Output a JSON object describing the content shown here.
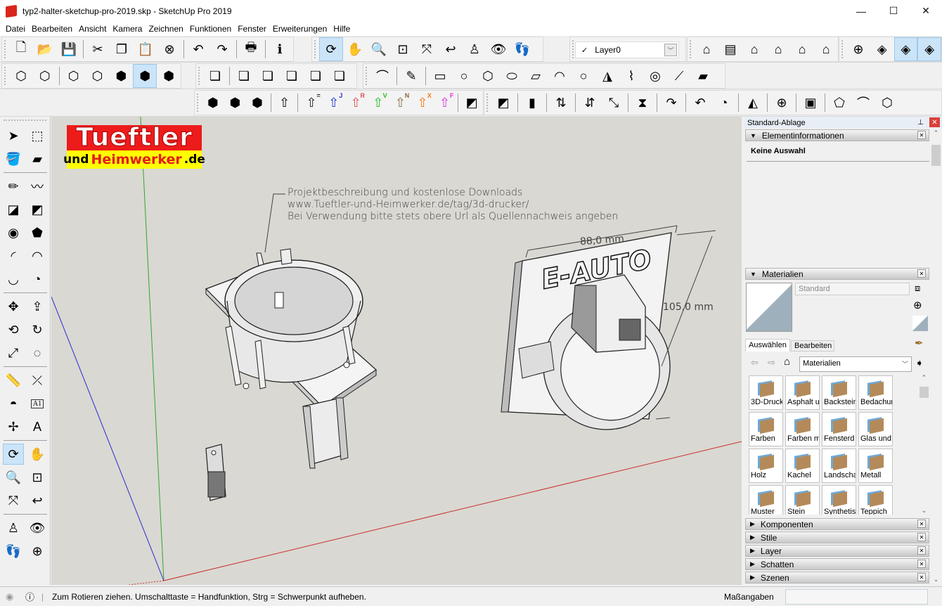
{
  "window": {
    "title": "typ2-halter-sketchup-pro-2019.skp - SketchUp Pro 2019",
    "app_icon": "sketchup-logo-icon",
    "controls": {
      "minimize": "—",
      "maximize": "☐",
      "close": "✕"
    }
  },
  "menubar": [
    "Datei",
    "Bearbeiten",
    "Ansicht",
    "Kamera",
    "Zeichnen",
    "Funktionen",
    "Fenster",
    "Erweiterungen",
    "Hilfe"
  ],
  "toolbars": {
    "standard": [
      {
        "icon": "new-file-icon",
        "glyph": "🗋"
      },
      {
        "icon": "open-folder-icon",
        "glyph": "📂"
      },
      {
        "icon": "save-icon",
        "glyph": "💾"
      },
      {
        "icon": "cut-icon",
        "glyph": "✂"
      },
      {
        "icon": "copy-icon",
        "glyph": "❐"
      },
      {
        "icon": "paste-icon",
        "glyph": "📋"
      },
      {
        "icon": "erase-circle-icon",
        "glyph": "⊗"
      },
      {
        "icon": "undo-icon",
        "glyph": "↶"
      },
      {
        "icon": "redo-icon",
        "glyph": "↷"
      },
      {
        "icon": "print-icon",
        "glyph": "🖶"
      },
      {
        "icon": "model-info-icon",
        "glyph": "ℹ"
      }
    ],
    "camera": [
      {
        "icon": "orbit-icon",
        "glyph": "⟳",
        "active": true
      },
      {
        "icon": "pan-hand-icon",
        "glyph": "✋"
      },
      {
        "icon": "zoom-icon",
        "glyph": "🔍"
      },
      {
        "icon": "zoom-window-icon",
        "glyph": "⊡"
      },
      {
        "icon": "zoom-extents-icon",
        "glyph": "⤧"
      },
      {
        "icon": "previous-view-icon",
        "glyph": "↩"
      },
      {
        "icon": "position-camera-icon",
        "glyph": "♙"
      },
      {
        "icon": "look-around-eye-icon",
        "glyph": "👁"
      },
      {
        "icon": "walk-footprints-icon",
        "glyph": "👣"
      }
    ],
    "layer": {
      "check": "✓",
      "current": "Layer0"
    },
    "views": [
      {
        "icon": "iso-view-icon",
        "glyph": "⌂"
      },
      {
        "icon": "top-view-icon",
        "glyph": "▤"
      },
      {
        "icon": "front-view-icon",
        "glyph": "⌂"
      },
      {
        "icon": "right-view-icon",
        "glyph": "⌂"
      },
      {
        "icon": "back-view-icon",
        "glyph": "⌂"
      },
      {
        "icon": "left-view-icon",
        "glyph": "⌂"
      }
    ],
    "sections": [
      {
        "icon": "section-plane-icon",
        "glyph": "⊕"
      },
      {
        "icon": "section-cut-icon",
        "glyph": "◈"
      },
      {
        "icon": "display-section-planes-icon",
        "glyph": "◈",
        "active": true
      },
      {
        "icon": "display-section-cuts-icon",
        "glyph": "◈",
        "active": true
      }
    ],
    "styles": [
      {
        "icon": "xray-style-icon",
        "glyph": "⬡"
      },
      {
        "icon": "back-edges-style-icon",
        "glyph": "⬡"
      },
      {
        "icon": "wireframe-style-icon",
        "glyph": "⬡"
      },
      {
        "icon": "hidden-line-style-icon",
        "glyph": "⬡"
      },
      {
        "icon": "shaded-style-icon",
        "glyph": "⬢"
      },
      {
        "icon": "shaded-textures-style-icon",
        "glyph": "⬢",
        "active": true
      },
      {
        "icon": "monochrome-style-icon",
        "glyph": "⬢"
      }
    ],
    "solid_tools": [
      {
        "icon": "outer-shell-icon",
        "glyph": "❏"
      },
      {
        "icon": "intersect-icon",
        "glyph": "❏"
      },
      {
        "icon": "union-icon",
        "glyph": "❏"
      },
      {
        "icon": "subtract-icon",
        "glyph": "❏"
      },
      {
        "icon": "trim-icon",
        "glyph": "❏"
      },
      {
        "icon": "split-icon",
        "glyph": "❏"
      }
    ],
    "sandbox_draw": [
      {
        "icon": "sandbox-surface-icon",
        "glyph": "⌒"
      },
      {
        "icon": "pencil-arc-icon",
        "glyph": "✎"
      },
      {
        "icon": "rectangle-shape-icon",
        "glyph": "▭"
      },
      {
        "icon": "circle-shape-icon",
        "glyph": "○"
      },
      {
        "icon": "polygon-shape-icon",
        "glyph": "⬡"
      },
      {
        "icon": "ellipse-shape-icon",
        "glyph": "⬭"
      },
      {
        "icon": "parallelogram-shape-icon",
        "glyph": "▱"
      },
      {
        "icon": "arc-shape-icon",
        "glyph": "◠"
      },
      {
        "icon": "circle-shape-icon-2",
        "glyph": "○"
      },
      {
        "icon": "cone-shape-icon",
        "glyph": "◮"
      },
      {
        "icon": "curve-shape-icon",
        "glyph": "⌇"
      },
      {
        "icon": "cylinder-shape-icon",
        "glyph": "◎"
      },
      {
        "icon": "red-line-icon",
        "glyph": "⟋"
      },
      {
        "icon": "eraser-pink-icon",
        "glyph": "▰"
      }
    ],
    "push_pull": [
      {
        "icon": "round-corner-icon",
        "glyph": "⬢"
      },
      {
        "icon": "bevel-corner-icon",
        "glyph": "⬢"
      },
      {
        "icon": "chamfer-corner-icon",
        "glyph": "⬢"
      },
      {
        "icon": "push-pull-dropdown-icon",
        "glyph": "⇧"
      },
      {
        "icon": "joint-push-pull-icon",
        "glyph": "⇧",
        "badge": "=",
        "color": "#222222"
      },
      {
        "icon": "joint-push-pull-j-icon",
        "glyph": "⇧",
        "badge": "J",
        "color": "#2233cc"
      },
      {
        "icon": "joint-push-pull-r-icon",
        "glyph": "⇧",
        "badge": "R",
        "color": "#e05050"
      },
      {
        "icon": "joint-push-pull-v-icon",
        "glyph": "⇧",
        "badge": "V",
        "color": "#22bb22"
      },
      {
        "icon": "joint-push-pull-n-icon",
        "glyph": "⇧",
        "badge": "N",
        "color": "#8a6a40"
      },
      {
        "icon": "joint-push-pull-x-icon",
        "glyph": "⇧",
        "badge": "X",
        "color": "#f07a10"
      },
      {
        "icon": "joint-push-pull-f-icon",
        "glyph": "⇧",
        "badge": "F",
        "color": "#dd33dd"
      },
      {
        "icon": "fredo-scale-box-icon",
        "glyph": "◩"
      }
    ],
    "misc": [
      {
        "icon": "fredo-scale-plane-icon",
        "glyph": "◩"
      },
      {
        "icon": "fredo-stretch-icon",
        "glyph": "▮"
      },
      {
        "icon": "fredo-tube-icon",
        "glyph": "⇅"
      },
      {
        "icon": "flip-updown-icon",
        "glyph": "⇵"
      },
      {
        "icon": "diagonal-arrows-icon",
        "glyph": "⤡"
      },
      {
        "icon": "taper-icon",
        "glyph": "⧗"
      },
      {
        "icon": "rotate-blue-icon",
        "glyph": "↷"
      },
      {
        "icon": "rotate-red-icon",
        "glyph": "↶"
      },
      {
        "icon": "bend-icon",
        "glyph": "◔"
      },
      {
        "icon": "mirror-icon",
        "glyph": "◭"
      },
      {
        "icon": "globe-icon",
        "glyph": "⊕"
      },
      {
        "icon": "solid-inspector-icon",
        "glyph": "▣"
      },
      {
        "icon": "freehand-shape-icon",
        "glyph": "⬠"
      },
      {
        "icon": "path-tool-icon",
        "glyph": "⌒"
      },
      {
        "icon": "wireframe-mesh-icon",
        "glyph": "⬡"
      }
    ]
  },
  "left_tools": [
    {
      "icon": "select-arrow-icon",
      "glyph": "➤"
    },
    {
      "icon": "make-component-icon",
      "glyph": "⬚"
    },
    {
      "icon": "paint-bucket-icon",
      "glyph": "🪣"
    },
    {
      "icon": "eraser-icon",
      "glyph": "▰"
    },
    {
      "icon": "pencil-line-icon",
      "glyph": "✏"
    },
    {
      "icon": "freehand-icon",
      "glyph": "〰"
    },
    {
      "icon": "rectangle-icon",
      "glyph": "◪"
    },
    {
      "icon": "rotated-rectangle-icon",
      "glyph": "◩"
    },
    {
      "icon": "circle-icon",
      "glyph": "◉"
    },
    {
      "icon": "polygon-icon",
      "glyph": "⬟"
    },
    {
      "icon": "arc-icon",
      "glyph": "◜"
    },
    {
      "icon": "two-point-arc-icon",
      "glyph": "◠"
    },
    {
      "icon": "three-point-arc-icon",
      "glyph": "◡"
    },
    {
      "icon": "pie-icon",
      "glyph": "◔"
    },
    {
      "icon": "move-icon",
      "glyph": "✥"
    },
    {
      "icon": "push-pull-icon",
      "glyph": "⇪"
    },
    {
      "icon": "rotate-icon",
      "glyph": "⟲"
    },
    {
      "icon": "follow-me-icon",
      "glyph": "↻"
    },
    {
      "icon": "scale-icon",
      "glyph": "⤢"
    },
    {
      "icon": "offset-icon",
      "glyph": "◌"
    },
    {
      "icon": "tape-measure-icon",
      "glyph": "📏"
    },
    {
      "icon": "dimension-icon",
      "glyph": "⤫"
    },
    {
      "icon": "protractor-icon",
      "glyph": "◓"
    },
    {
      "icon": "text-label-icon",
      "glyph": "A1"
    },
    {
      "icon": "axes-icon",
      "glyph": "✢"
    },
    {
      "icon": "3d-text-icon",
      "glyph": "A"
    },
    {
      "icon": "orbit-icon",
      "glyph": "⟳",
      "active": true
    },
    {
      "icon": "pan-hand-icon",
      "glyph": "✋"
    },
    {
      "icon": "zoom-icon",
      "glyph": "🔍"
    },
    {
      "icon": "zoom-window-icon",
      "glyph": "⊡"
    },
    {
      "icon": "zoom-extents-icon",
      "glyph": "⤧"
    },
    {
      "icon": "previous-view-icon",
      "glyph": "↩"
    },
    {
      "icon": "position-camera-icon",
      "glyph": "♙"
    },
    {
      "icon": "look-around-eye-icon",
      "glyph": "👁"
    },
    {
      "icon": "walk-footprints-icon",
      "glyph": "👣"
    },
    {
      "icon": "section-plane-icon",
      "glyph": "⊕"
    }
  ],
  "viewport": {
    "logo": {
      "line1": "Tueftler",
      "line2_a": "und",
      "line2_b": "Heimwerker",
      "line2_c": ".de"
    },
    "note": [
      "Projektbeschreibung und kostenlose Downloads",
      "www.Tueftler-und-Heimwerker.de/tag/3d-drucker/",
      "Bei Verwendung bitte stets obere Url als Quellennachweis angeben"
    ],
    "dimension_width": "88,0 mm",
    "dimension_height": "105,0 mm",
    "plate_text": "E-AUTO"
  },
  "tray": {
    "title": "Standard-Ablage",
    "pin": "📌",
    "entity_info": {
      "title": "Elementinformationen",
      "status": "Keine Auswahl"
    },
    "materials": {
      "title": "Materialien",
      "name_placeholder": "Standard",
      "tabs": [
        "Auswählen",
        "Bearbeiten"
      ],
      "collection": "Materialien",
      "items": [
        "3D-Druck",
        "Asphalt u",
        "Backstein",
        "Bedachun",
        "Farben",
        "Farben m",
        "Fensterd",
        "Glas und",
        "Holz",
        "Kachel",
        "Landscha",
        "Metall",
        "Muster",
        "Stein",
        "Synthetis",
        "Teppich"
      ]
    },
    "collapsed_panels": [
      "Komponenten",
      "Stile",
      "Layer",
      "Schatten",
      "Szenen"
    ]
  },
  "statusbar": {
    "text": "Zum Rotieren ziehen. Umschalttaste = Handfunktion, Strg = Schwerpunkt aufheben.",
    "measurements_label": "Maßangaben",
    "measurements_value": ""
  }
}
